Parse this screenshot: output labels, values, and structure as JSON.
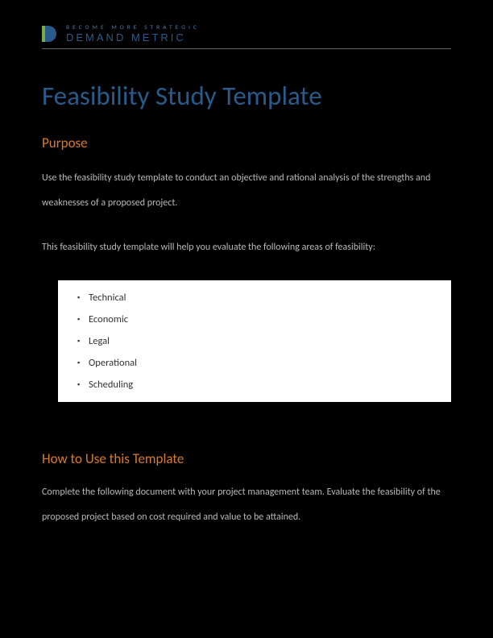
{
  "header": {
    "tagline": "Become More Strategic",
    "brand": "Demand Metric"
  },
  "title": "Feasibility Study Template",
  "section1": {
    "heading": "Purpose",
    "para1": "Use the feasibility study template to conduct an objective and rational analysis of the strengths and weaknesses of a proposed project.",
    "para2": "This feasibility study template will help you evaluate the following areas of feasibility:",
    "items": {
      "i0": "Technical",
      "i1": "Economic",
      "i2": "Legal",
      "i3": "Operational",
      "i4": "Scheduling"
    }
  },
  "section2": {
    "heading": "How to Use this Template",
    "para1": "Complete the following document with your project management team. Evaluate the feasibility of the proposed project based on cost required and value to be attained."
  }
}
